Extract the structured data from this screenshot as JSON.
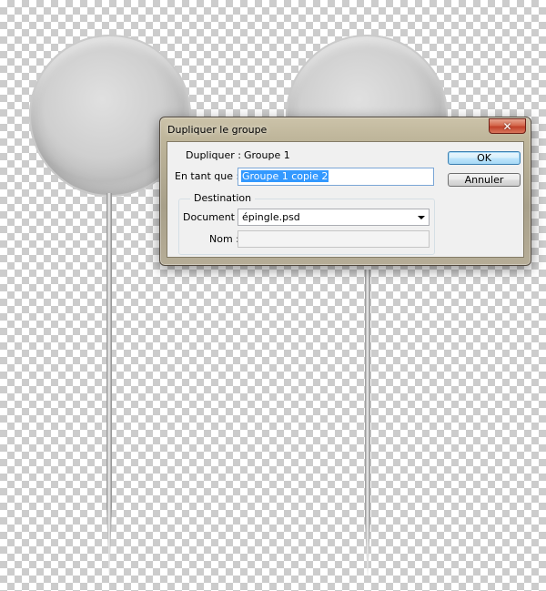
{
  "dialog": {
    "title": "Dupliquer le groupe",
    "close_symbol": "✕",
    "close_icon": "close-icon",
    "duplicate_label": "Dupliquer :",
    "duplicate_value": "Groupe 1",
    "as_label": "En tant que :",
    "as_value": "Groupe 1 copie 2",
    "destination": {
      "legend": "Destination",
      "document_label": "Document :",
      "document_value": "épingle.psd",
      "name_label": "Nom :",
      "name_value": ""
    },
    "ok_label": "OK",
    "cancel_label": "Annuler"
  },
  "colors": {
    "close_button": "#c7432b",
    "selection": "#3399ff",
    "default_button_border": "#3c7fb1"
  }
}
